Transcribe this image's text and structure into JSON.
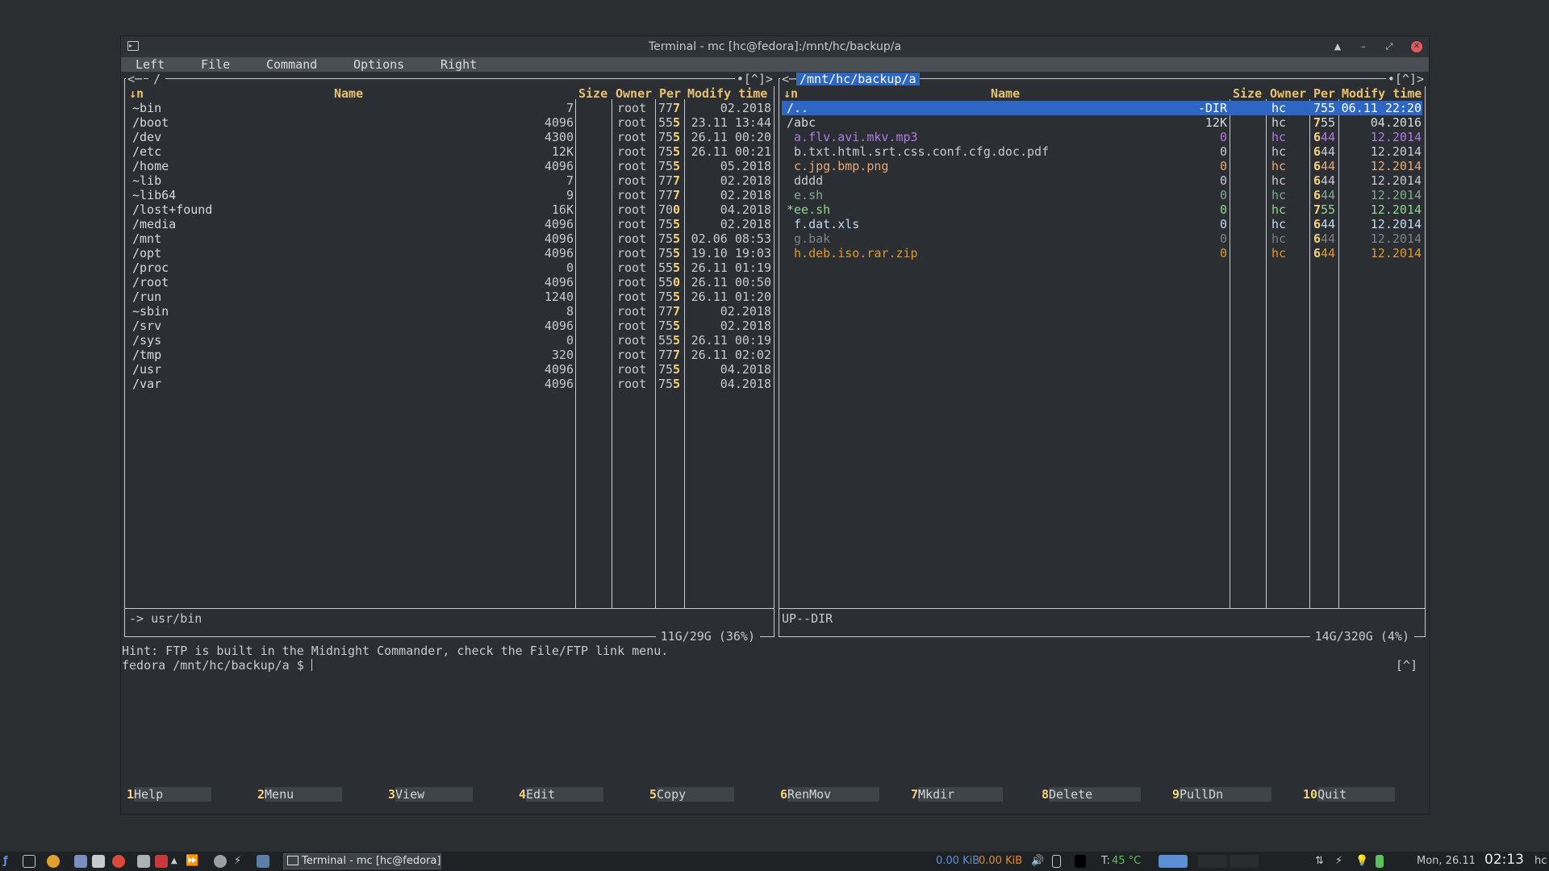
{
  "window": {
    "title": "Terminal - mc [hc@fedora]:/mnt/hc/backup/a",
    "controls": {
      "up": "▲",
      "minimize": "–",
      "maximize": "⤢",
      "close": "✕"
    }
  },
  "menubar": [
    "Left",
    "File",
    "Command",
    "Options",
    "Right"
  ],
  "left_panel": {
    "path": "/",
    "corner": "•[^]>",
    "corner_left": "<─",
    "headers": {
      "sort": "↓n",
      "name": "Name",
      "size": "Size",
      "owner": "Owner",
      "perm": "Per",
      "mtime": "Modify time"
    },
    "rows": [
      {
        "name": "~bin",
        "size": "7",
        "owner": "root",
        "perm1": "77",
        "perm2": "7",
        "mtime": "02.2018"
      },
      {
        "name": "/boot",
        "size": "4096",
        "owner": "root",
        "perm1": "55",
        "perm2": "5",
        "mtime": "23.11 13:44"
      },
      {
        "name": "/dev",
        "size": "4300",
        "owner": "root",
        "perm1": "75",
        "perm2": "5",
        "mtime": "26.11 00:20"
      },
      {
        "name": "/etc",
        "size": "12K",
        "owner": "root",
        "perm1": "75",
        "perm2": "5",
        "mtime": "26.11 00:21"
      },
      {
        "name": "/home",
        "size": "4096",
        "owner": "root",
        "perm1": "75",
        "perm2": "5",
        "mtime": "05.2018"
      },
      {
        "name": "~lib",
        "size": "7",
        "owner": "root",
        "perm1": "77",
        "perm2": "7",
        "mtime": "02.2018"
      },
      {
        "name": "~lib64",
        "size": "9",
        "owner": "root",
        "perm1": "77",
        "perm2": "7",
        "mtime": "02.2018"
      },
      {
        "name": "/lost+found",
        "size": "16K",
        "owner": "root",
        "perm1": "70",
        "perm2": "0",
        "mtime": "04.2018"
      },
      {
        "name": "/media",
        "size": "4096",
        "owner": "root",
        "perm1": "75",
        "perm2": "5",
        "mtime": "02.2018"
      },
      {
        "name": "/mnt",
        "size": "4096",
        "owner": "root",
        "perm1": "75",
        "perm2": "5",
        "mtime": "02.06 08:53"
      },
      {
        "name": "/opt",
        "size": "4096",
        "owner": "root",
        "perm1": "75",
        "perm2": "5",
        "mtime": "19.10 19:03"
      },
      {
        "name": "/proc",
        "size": "0",
        "owner": "root",
        "perm1": "55",
        "perm2": "5",
        "mtime": "26.11 01:19"
      },
      {
        "name": "/root",
        "size": "4096",
        "owner": "root",
        "perm1": "55",
        "perm2": "0",
        "mtime": "26.11 00:50"
      },
      {
        "name": "/run",
        "size": "1240",
        "owner": "root",
        "perm1": "75",
        "perm2": "5",
        "mtime": "26.11 01:20"
      },
      {
        "name": "~sbin",
        "size": "8",
        "owner": "root",
        "perm1": "77",
        "perm2": "7",
        "mtime": "02.2018"
      },
      {
        "name": "/srv",
        "size": "4096",
        "owner": "root",
        "perm1": "75",
        "perm2": "5",
        "mtime": "02.2018"
      },
      {
        "name": "/sys",
        "size": "0",
        "owner": "root",
        "perm1": "55",
        "perm2": "5",
        "mtime": "26.11 00:19"
      },
      {
        "name": "/tmp",
        "size": "320",
        "owner": "root",
        "perm1": "77",
        "perm2": "7",
        "mtime": "26.11 02:02"
      },
      {
        "name": "/usr",
        "size": "4096",
        "owner": "root",
        "perm1": "75",
        "perm2": "5",
        "mtime": "04.2018"
      },
      {
        "name": "/var",
        "size": "4096",
        "owner": "root",
        "perm1": "75",
        "perm2": "5",
        "mtime": "04.2018"
      }
    ],
    "mini_status": "-> usr/bin",
    "disk": "11G/29G (36%)"
  },
  "right_panel": {
    "path": "/mnt/hc/backup/a",
    "corner": "•[^]>",
    "corner_left": "<─",
    "headers": {
      "sort": "↓n",
      "name": "Name",
      "size": "Size",
      "owner": "Owner",
      "perm": "Per",
      "mtime": "Modify time"
    },
    "rows": [
      {
        "name": "/..",
        "size": "-DIR",
        "owner": "hc",
        "perm1": "7",
        "perm2": "55",
        "mtime": "06.11 22:20",
        "color": "#ffffff",
        "selected": true
      },
      {
        "name": "/abc",
        "size": "12K",
        "owner": "hc",
        "perm1": "7",
        "perm2": "55",
        "mtime": "04.2016",
        "color": "#d7d9db"
      },
      {
        "name": " a.flv.avi.mkv.mp3",
        "size": "0",
        "owner": "hc",
        "perm1": "6",
        "perm2": "44",
        "mtime": "12.2014",
        "color": "#b07ae0"
      },
      {
        "name": " b.txt.html.srt.css.conf.cfg.doc.pdf",
        "size": "0",
        "owner": "hc",
        "perm1": "6",
        "perm2": "44",
        "mtime": "12.2014",
        "color": "#c7cacc"
      },
      {
        "name": " c.jpg.bmp.png",
        "size": "0",
        "owner": "hc",
        "perm1": "6",
        "perm2": "44",
        "mtime": "12.2014",
        "color": "#e6a77a"
      },
      {
        "name": " dddd",
        "size": "0",
        "owner": "hc",
        "perm1": "6",
        "perm2": "44",
        "mtime": "12.2014",
        "color": "#c7cacc"
      },
      {
        "name": " e.sh",
        "size": "0",
        "owner": "hc",
        "perm1": "6",
        "perm2": "44",
        "mtime": "12.2014",
        "color": "#7fa890"
      },
      {
        "name": "*ee.sh",
        "size": "0",
        "owner": "hc",
        "perm1": "7",
        "perm2": "55",
        "mtime": "12.2014",
        "color": "#8fd68f"
      },
      {
        "name": " f.dat.xls",
        "size": "0",
        "owner": "hc",
        "perm1": "6",
        "perm2": "44",
        "mtime": "12.2014",
        "color": "#c2d8f0"
      },
      {
        "name": " g.bak",
        "size": "0",
        "owner": "hc",
        "perm1": "6",
        "perm2": "44",
        "mtime": "12.2014",
        "color": "#7d8286"
      },
      {
        "name": " h.deb.iso.rar.zip",
        "size": "0",
        "owner": "hc",
        "perm1": "6",
        "perm2": "44",
        "mtime": "12.2014",
        "color": "#e0982a"
      }
    ],
    "mini_status": "UP--DIR",
    "disk": "14G/320G (4%)"
  },
  "hint": "Hint: FTP is built in the Midnight Commander, check the File/FTP link menu.",
  "prompt": "fedora /mnt/hc/backup/a $ ",
  "prompt_corner": "[^]",
  "fkeys": [
    {
      "num": "1",
      "label": "Help"
    },
    {
      "num": "2",
      "label": "Menu"
    },
    {
      "num": "3",
      "label": "View"
    },
    {
      "num": "4",
      "label": "Edit"
    },
    {
      "num": "5",
      "label": "Copy"
    },
    {
      "num": "6",
      "label": "RenMov"
    },
    {
      "num": "7",
      "label": "Mkdir"
    },
    {
      "num": "8",
      "label": "Delete"
    },
    {
      "num": "9",
      "label": "PullDn"
    },
    {
      "num": "10",
      "label": "Quit"
    }
  ],
  "taskbar": {
    "task_label": "Terminal - mc [hc@fedora]...",
    "net_down": "0.00 KiB",
    "net_up": "0.00 KiB",
    "temp_label": "T:",
    "temp_value": "45 °C",
    "date": "Mon, 26.11",
    "time": "02:13",
    "user": "hc"
  },
  "colors": {
    "accent": "#2e66c3",
    "highlight": "#f2d27a",
    "net_down": "#5c8fd6",
    "net_up": "#e0892a",
    "temp": "#5cc05c"
  }
}
